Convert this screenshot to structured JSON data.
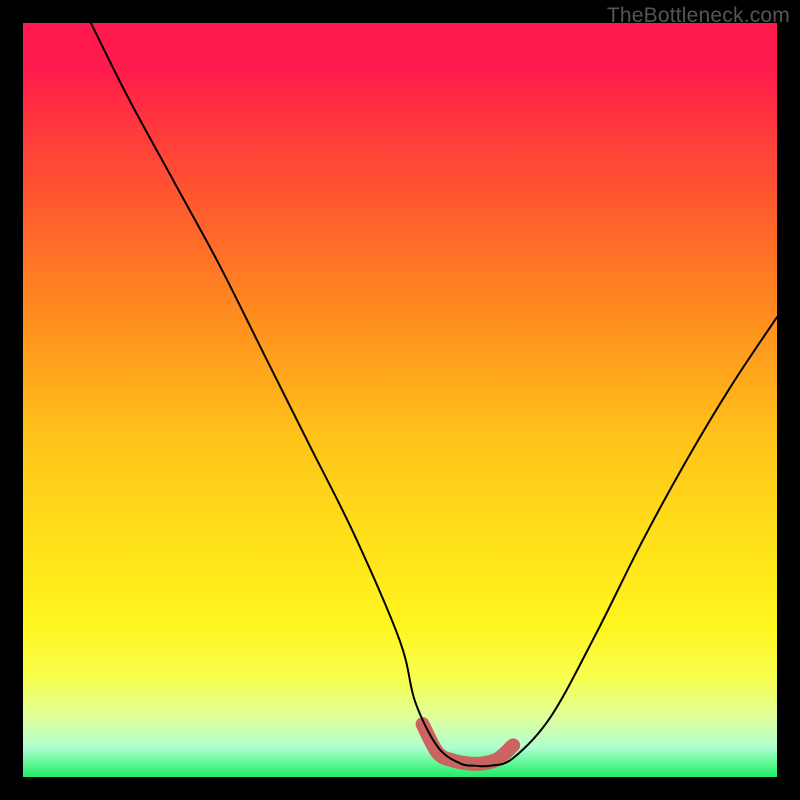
{
  "watermark": "TheBottleneck.com",
  "chart_data": {
    "type": "line",
    "title": "",
    "xlabel": "",
    "ylabel": "",
    "xlim": [
      0,
      100
    ],
    "ylim": [
      0,
      100
    ],
    "series": [
      {
        "name": "bottleneck-curve",
        "x": [
          9,
          14,
          20,
          26,
          32,
          38,
          44,
          50,
          52,
          55,
          58,
          60,
          62,
          65,
          70,
          76,
          82,
          88,
          94,
          100
        ],
        "y": [
          100,
          90,
          79,
          68,
          56,
          44,
          32,
          18,
          10,
          4,
          1.8,
          1.5,
          1.5,
          2.5,
          8,
          19,
          31,
          42,
          52,
          61
        ]
      }
    ],
    "annotations": [
      {
        "name": "optimal-zone",
        "x": [
          53,
          55,
          57,
          59,
          61,
          63,
          65
        ],
        "y": [
          7,
          3.2,
          2.2,
          1.8,
          1.8,
          2.4,
          4.2
        ]
      }
    ],
    "gradient_scale": {
      "top_color": "#ff1a4d",
      "mid_color": "#ffe31a",
      "bottom_color": "#1eef65",
      "meaning": "red=bad, green=good"
    }
  }
}
